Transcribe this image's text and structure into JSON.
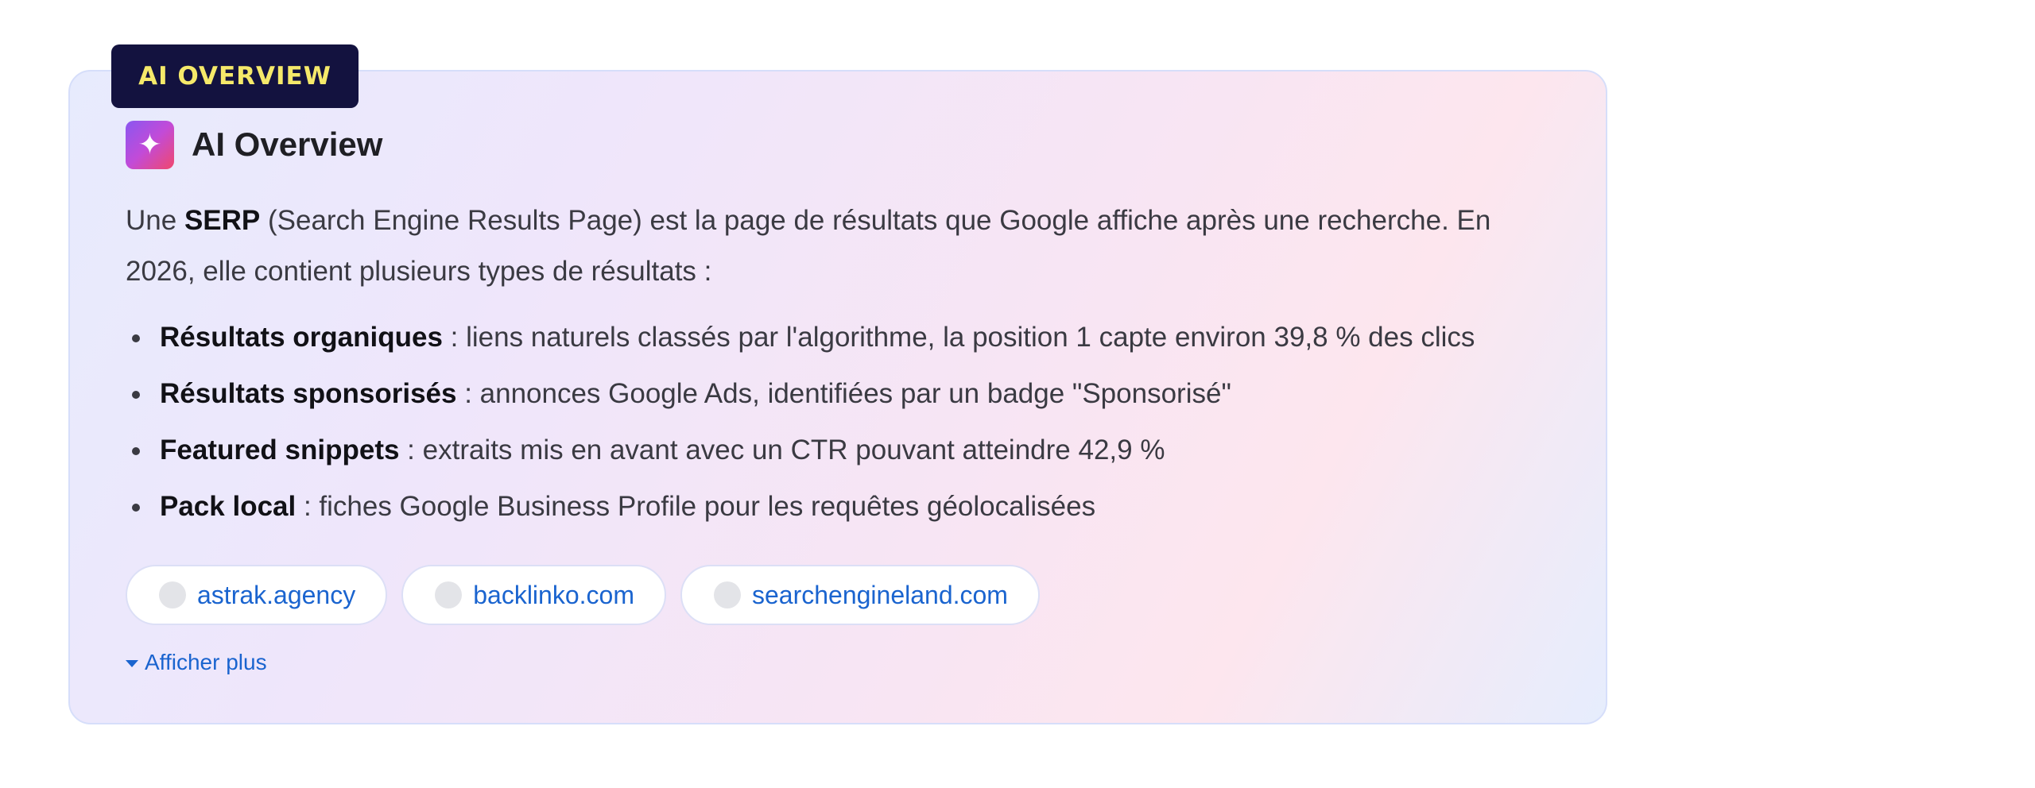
{
  "badge": {
    "label": "AI OVERVIEW"
  },
  "header": {
    "title": "AI Overview"
  },
  "intro": {
    "prefix": "Une ",
    "term": "SERP",
    "rest": " (Search Engine Results Page) est la page de résultats que Google affiche après une recherche. En 2026, elle contient plusieurs types de résultats :"
  },
  "bullets": [
    {
      "term": "Résultats organiques",
      "text": " : liens naturels classés par l'algorithme, la position 1 capte environ 39,8 % des clics"
    },
    {
      "term": "Résultats sponsorisés",
      "text": " : annonces Google Ads, identifiées par un badge \"Sponsorisé\""
    },
    {
      "term": "Featured snippets",
      "text": " : extraits mis en avant avec un CTR pouvant atteindre 42,9 %"
    },
    {
      "term": "Pack local",
      "text": " : fiches Google Business Profile pour les requêtes géolocalisées"
    }
  ],
  "sources": [
    {
      "label": "astrak.agency"
    },
    {
      "label": "backlinko.com"
    },
    {
      "label": "searchengineland.com"
    }
  ],
  "more": {
    "label": "Afficher plus"
  },
  "colors": {
    "badge_bg": "#13123f",
    "badge_text": "#f5e96a",
    "link": "#1a64cf",
    "body_text": "#3a3a42"
  },
  "icons": {
    "header": "sparkle-icon",
    "source": "favicon-icon",
    "more": "caret-down-icon"
  }
}
